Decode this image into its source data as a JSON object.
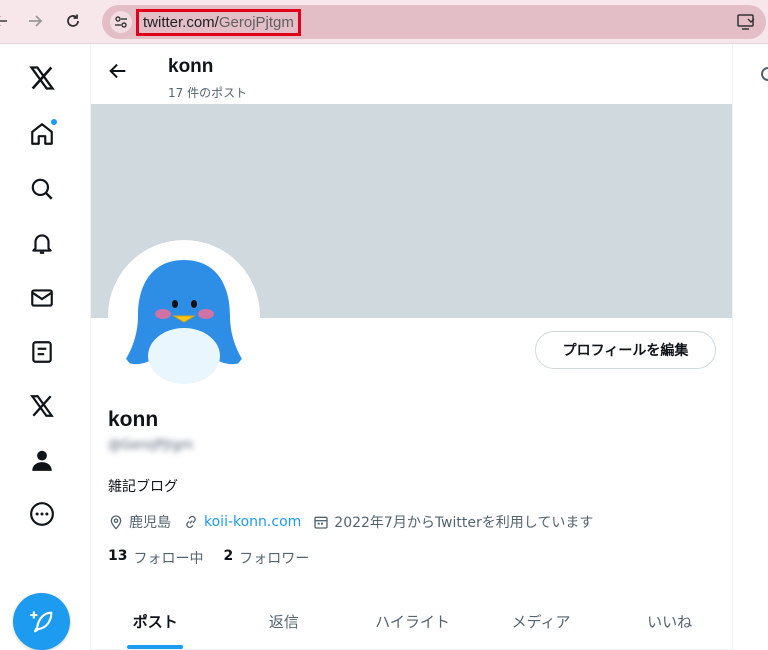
{
  "browser": {
    "url_host": "twitter.com/",
    "url_path": "GerojPjtgm",
    "back_icon": "arrow-left-icon",
    "forward_icon": "arrow-right-icon",
    "reload_icon": "reload-icon"
  },
  "header": {
    "name": "konn",
    "post_count": "17 件のポスト"
  },
  "profile": {
    "display_name": "konn",
    "handle": "@GerojPjtgm",
    "bio": "雑記ブログ",
    "location": "鹿児島",
    "website": "koii-konn.com",
    "joined": "2022年7月からTwitterを利用しています",
    "following_count": "13",
    "following_label": "フォロー中",
    "followers_count": "2",
    "followers_label": "フォロワー",
    "edit_button": "プロフィールを編集"
  },
  "tabs": [
    {
      "label": "ポスト",
      "active": true
    },
    {
      "label": "返信",
      "active": false
    },
    {
      "label": "ハイライト",
      "active": false
    },
    {
      "label": "メディア",
      "active": false
    },
    {
      "label": "いいね",
      "active": false
    }
  ],
  "colors": {
    "accent": "#1d9bf0",
    "banner": "#cfd9de",
    "browser_bar": "#f8e7ea",
    "url_highlight": "#e0001b"
  }
}
